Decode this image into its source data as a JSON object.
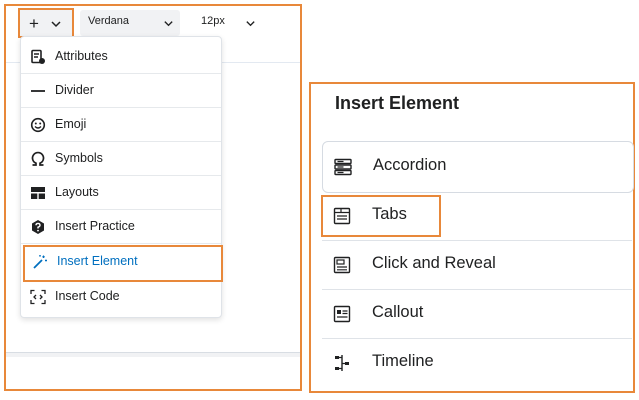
{
  "toolbar": {
    "insert_button": {
      "label": "+",
      "icon": "plus-icon",
      "chevron": "chevron-down-icon"
    },
    "font_family": {
      "value": "Verdana"
    },
    "font_size": {
      "value": "12px"
    }
  },
  "insert_menu": {
    "items": [
      {
        "label": "Attributes",
        "icon": "attributes-icon"
      },
      {
        "label": "Divider",
        "icon": "divider-icon"
      },
      {
        "label": "Emoji",
        "icon": "emoji-icon"
      },
      {
        "label": "Symbols",
        "icon": "omega-icon"
      },
      {
        "label": "Layouts",
        "icon": "layout-icon"
      },
      {
        "label": "Insert Practice",
        "icon": "question-badge-icon"
      },
      {
        "label": "Insert Element",
        "icon": "magic-wand-icon",
        "selected": true
      },
      {
        "label": "Insert Code",
        "icon": "code-icon"
      }
    ]
  },
  "insert_element_panel": {
    "title": "Insert Element",
    "items": [
      {
        "label": "Accordion",
        "icon": "accordion-icon"
      },
      {
        "label": "Tabs",
        "icon": "tabs-icon"
      },
      {
        "label": "Click and Reveal",
        "icon": "click-reveal-icon"
      },
      {
        "label": "Callout",
        "icon": "callout-icon"
      },
      {
        "label": "Timeline",
        "icon": "timeline-icon"
      }
    ]
  },
  "colors": {
    "highlight": "#e8883a",
    "selected_text": "#006fbf",
    "text": "#202122"
  }
}
